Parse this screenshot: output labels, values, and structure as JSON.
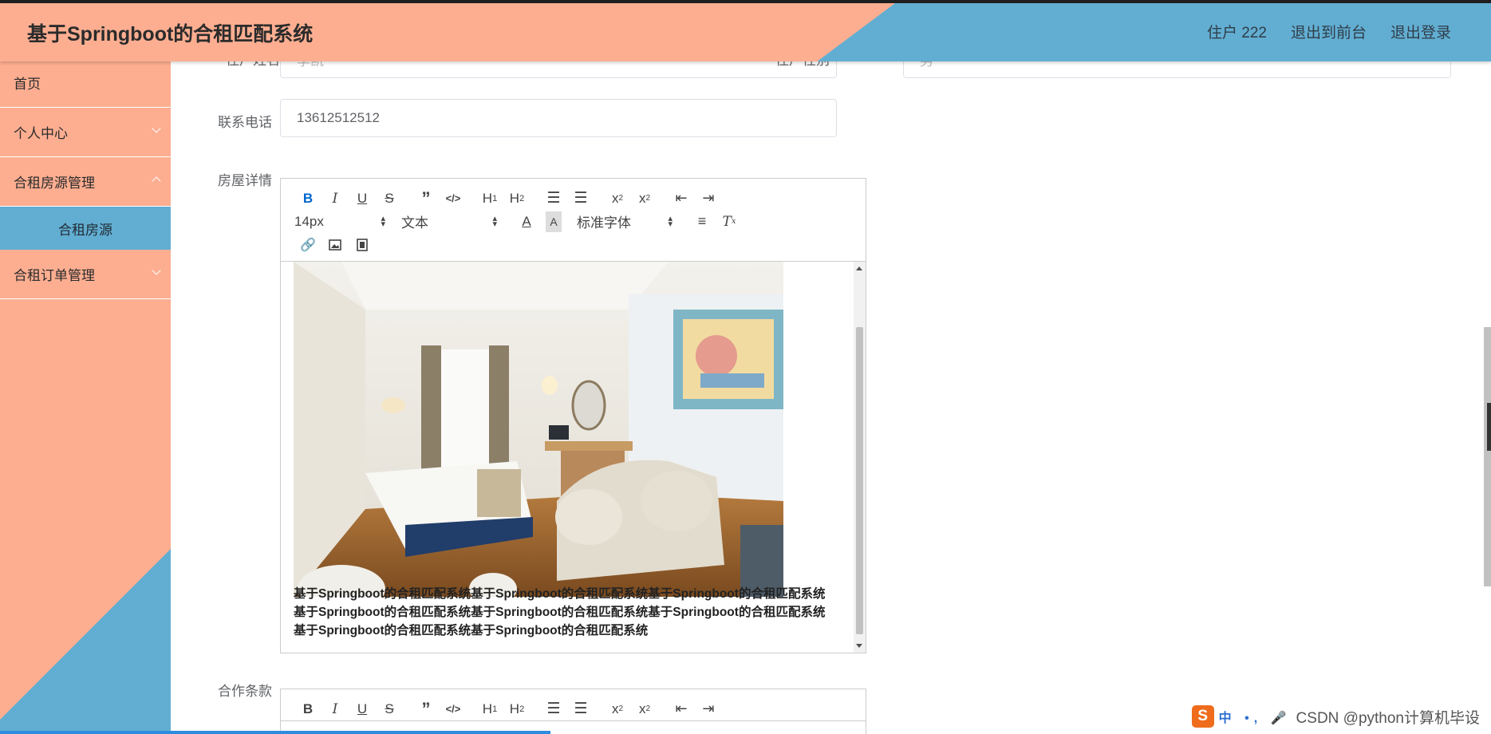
{
  "header": {
    "title": "基于Springboot的合租匹配系统",
    "user": "住户 222",
    "back_front": "退出到前台",
    "logout": "退出登录"
  },
  "sidebar": {
    "items": [
      {
        "label": "首页"
      },
      {
        "label": "个人中心"
      },
      {
        "label": "合租房源管理"
      },
      {
        "label": "合租房源"
      },
      {
        "label": "合租订单管理"
      }
    ]
  },
  "form": {
    "name_label_partial": "住户姓名",
    "name_value_partial": "李凯",
    "gender_label_partial": "住户性别",
    "gender_value_partial": "男",
    "phone_label": "联系电话",
    "phone_value": "13612512512",
    "detail_label": "房屋详情",
    "terms_label": "合作条款"
  },
  "editor": {
    "font_size": "14px",
    "text_style": "文本",
    "font_family": "标准字体",
    "content_text": "基于Springboot的合租匹配系统基于Springboot的合租匹配系统基于Springboot的合租匹配系统基于Springboot的合租匹配系统基于Springboot的合租匹配系统基于Springboot的合租匹配系统基于Springboot的合租匹配系统基于Springboot的合租匹配系统"
  },
  "watermark": {
    "ime": "中 •, 🎤",
    "text": "CSDN @python计算机毕设"
  },
  "colors": {
    "salmon": "#fdae91",
    "blue": "#62aed2"
  }
}
